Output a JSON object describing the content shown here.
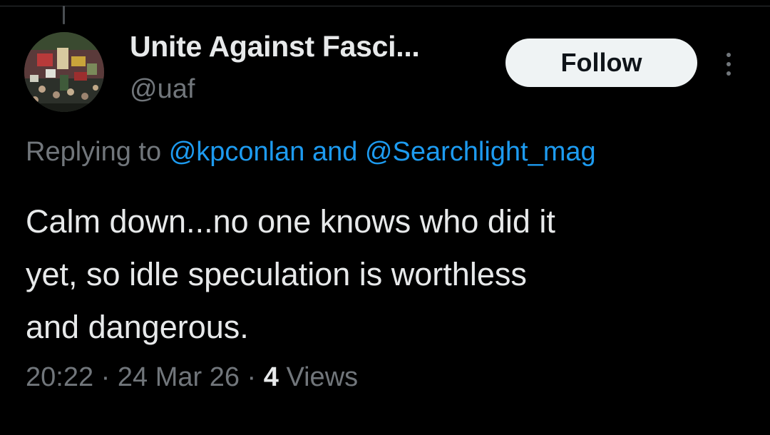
{
  "author": {
    "display_name": "Unite Against Fasci...",
    "handle": "@uaf"
  },
  "actions": {
    "follow_label": "Follow",
    "more_icon": "more-vertical-icon"
  },
  "reply": {
    "prefix": "Replying to",
    "mention_1": "@kpconlan",
    "conjunction": "and",
    "mention_2": "@Searchlight_mag"
  },
  "tweet": {
    "lines": [
      "Calm down...no one knows who did it",
      "yet, so idle speculation is worthless",
      "and dangerous."
    ]
  },
  "meta": {
    "time": "20:22",
    "separator": "·",
    "date": "24 Mar 26",
    "views_count": "4",
    "views_label": "Views"
  },
  "colors": {
    "background": "#000000",
    "primary_text": "#e7e9ea",
    "secondary_text": "#71767b",
    "accent": "#1d9bf0",
    "button_bg": "#eff3f4"
  }
}
